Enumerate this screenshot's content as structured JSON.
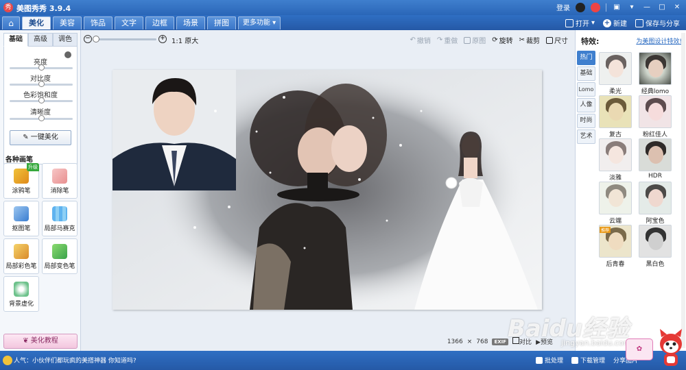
{
  "app": {
    "title": "美图秀秀 3.9.4",
    "logo_text": "秀",
    "login": "登录"
  },
  "main_tabs": [
    {
      "label": "⌂",
      "name": "tab-home",
      "active": false
    },
    {
      "label": "美化",
      "name": "tab-beautify",
      "active": true
    },
    {
      "label": "美容",
      "name": "tab-beauty"
    },
    {
      "label": "饰品",
      "name": "tab-accessory"
    },
    {
      "label": "文字",
      "name": "tab-text"
    },
    {
      "label": "边框",
      "name": "tab-border"
    },
    {
      "label": "场景",
      "name": "tab-scene"
    },
    {
      "label": "拼图",
      "name": "tab-collage"
    },
    {
      "label": "更多功能 ▾",
      "name": "tab-more"
    }
  ],
  "file_actions": {
    "open": "打开",
    "new": "新建",
    "save_share": "保存与分享"
  },
  "left": {
    "subtabs": [
      "基础",
      "高级",
      "调色"
    ],
    "sliders": [
      {
        "label": "亮度",
        "value": 0.5
      },
      {
        "label": "对比度",
        "value": 0.5
      },
      {
        "label": "色彩饱和度",
        "value": 0.5
      },
      {
        "label": "清晰度",
        "value": 0.5
      }
    ],
    "oneclick": "一键美化",
    "brush_title": "各种画笔",
    "brushes": [
      {
        "label": "涂鸦笔",
        "badge": "升级"
      },
      {
        "label": "消除笔"
      },
      {
        "label": "抠图笔"
      },
      {
        "label": "局部马赛克"
      },
      {
        "label": "局部彩色笔"
      },
      {
        "label": "局部变色笔"
      },
      {
        "label": "背景虚化"
      }
    ],
    "tutorial": "美化教程"
  },
  "toolbar": {
    "zoom_level": 0.2,
    "original_size": "1:1 原大",
    "undo": "撤销",
    "redo": "重做",
    "original": "原图",
    "rotate": "旋转",
    "crop": "裁剪",
    "size": "尺寸"
  },
  "canvas": {
    "width": "1366",
    "times": "×",
    "height": "768",
    "exif": "EXIF",
    "compare": "对比",
    "preview": "预览"
  },
  "right": {
    "title": "特效:",
    "link": "为美图设计特效!",
    "categories": [
      "热门",
      "基础",
      "Lomo",
      "人像",
      "时尚",
      "艺术"
    ],
    "effects": [
      {
        "label": "柔光"
      },
      {
        "label": "经典lomo"
      },
      {
        "label": "复古"
      },
      {
        "label": "粉红佳人"
      },
      {
        "label": "淡雅"
      },
      {
        "label": "HDR"
      },
      {
        "label": "云端"
      },
      {
        "label": "阿宝色"
      },
      {
        "label": "后青春",
        "badge": "推荐"
      },
      {
        "label": "黑白色"
      }
    ]
  },
  "status": {
    "text": "人气：小伙伴们都玩疯的美搭神器 你知道吗?",
    "batch": "批处理",
    "download": "下载管理",
    "share": "分享图片"
  },
  "watermark": {
    "text": "Baidu经验",
    "url": "jingyan.baidu.com"
  },
  "colors": {
    "brand_blue": "#2f6fc3",
    "accent_pink": "#e07cb7"
  }
}
